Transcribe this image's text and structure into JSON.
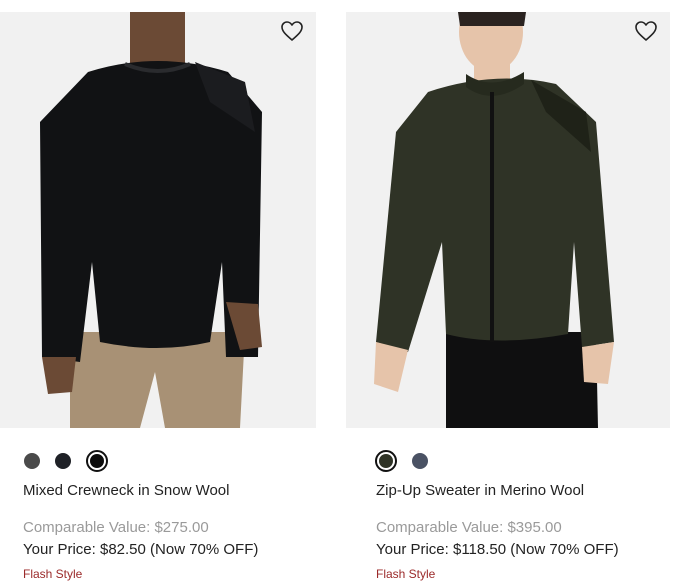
{
  "products": [
    {
      "name": "Mixed Crewneck in Snow Wool",
      "comparable_value": "Comparable Value: $275.00",
      "your_price": "Your Price: $82.50 (Now 70% OFF)",
      "badge": "Flash Style",
      "wishlist_icon": "heart-outline-icon",
      "swatches": [
        {
          "color": "#4a4a4a",
          "selected": false
        },
        {
          "color": "#1f2127",
          "selected": false
        },
        {
          "color": "#0b0b0b",
          "selected": true
        }
      ]
    },
    {
      "name": "Zip-Up Sweater in Merino Wool",
      "comparable_value": "Comparable Value: $395.00",
      "your_price": "Your Price: $118.50 (Now 70% OFF)",
      "badge": "Flash Style",
      "wishlist_icon": "heart-outline-icon",
      "swatches": [
        {
          "color": "#2f3326",
          "selected": true
        },
        {
          "color": "#4a5264",
          "selected": false
        }
      ]
    }
  ],
  "colors": {
    "badge": "#9b2a2a",
    "muted_text": "#9a9a9a",
    "image_background": "#f1f1f1"
  }
}
